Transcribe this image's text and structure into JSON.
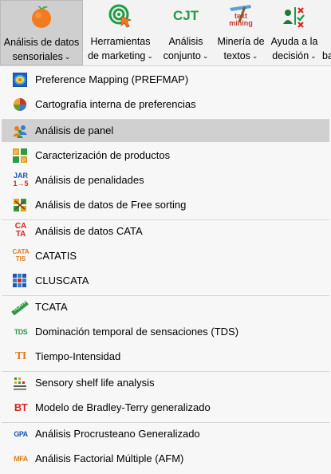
{
  "ribbon": {
    "buttons": [
      {
        "line1": "Análisis de datos",
        "line2": "sensoriales",
        "icon": "orange-fruit-icon"
      },
      {
        "line1": "Herramientas",
        "line2": "de marketing",
        "icon": "target-cursor-icon"
      },
      {
        "line1": "Análisis",
        "line2": "conjunto",
        "icon": "cjt-icon"
      },
      {
        "line1": "Minería de",
        "line2": "textos",
        "icon": "text-mining-icon"
      },
      {
        "line1": "Ayuda a la",
        "line2": "decisión",
        "icon": "decision-icon"
      },
      {
        "line1": "",
        "line2": "ba",
        "icon": ""
      }
    ],
    "cjt_text": "CJT",
    "textmining_top": "text",
    "textmining_bottom": "mining",
    "chevron": "⌄"
  },
  "menu": {
    "items": [
      {
        "label": "Preference Mapping (PREFMAP)",
        "icon": "prefmap-icon"
      },
      {
        "label": "Cartografía interna de preferencias",
        "icon": "internal-map-icon"
      },
      {
        "label": "Análisis de panel",
        "icon": "panel-analysis-icon",
        "highlighted": true
      },
      {
        "label": "Caracterización de productos",
        "icon": "product-characterization-icon"
      },
      {
        "label": "Análisis de penalidades",
        "icon": "penalty-analysis-icon",
        "icon_text_top": "JAR",
        "icon_text_bottom": "1→5"
      },
      {
        "label": "Análisis de datos de Free sorting",
        "icon": "free-sorting-icon"
      },
      {
        "label": "Análisis de datos CATA",
        "icon": "cata-icon",
        "icon_text_top": "CA",
        "icon_text_bottom": "TA"
      },
      {
        "label": "CATATIS",
        "icon": "catatis-icon",
        "icon_text_top": "CATA",
        "icon_text_bottom": "TIS"
      },
      {
        "label": "CLUSCATA",
        "icon": "cluscata-icon"
      },
      {
        "label": "TCATA",
        "icon": "tcata-icon",
        "icon_text": "TCATA"
      },
      {
        "label": "Dominación temporal de sensaciones (TDS)",
        "icon": "tds-icon",
        "icon_text": "TDS"
      },
      {
        "label": "Tiempo-Intensidad",
        "icon": "time-intensity-icon",
        "icon_text": "TI"
      },
      {
        "label": "Sensory shelf life analysis",
        "icon": "shelf-life-icon"
      },
      {
        "label": "Modelo de Bradley-Terry generalizado",
        "icon": "bradley-terry-icon",
        "icon_text": "BT"
      },
      {
        "label": "Análisis Procrusteano Generalizado",
        "icon": "gpa-icon",
        "icon_text": "GPA"
      },
      {
        "label": "Análisis Factorial Múltiple (AFM)",
        "icon": "mfa-icon",
        "icon_text": "MFA"
      }
    ]
  },
  "colors": {
    "ribbon_bg": "#f3f3f3",
    "active_button_bg": "#cfcfcf",
    "menu_bg": "#f7f7f7",
    "highlight_bg": "#d0d0d0",
    "orange": "#f47a1f",
    "green": "#1e9d45",
    "blue": "#1a57b8",
    "red": "#d6251f"
  }
}
